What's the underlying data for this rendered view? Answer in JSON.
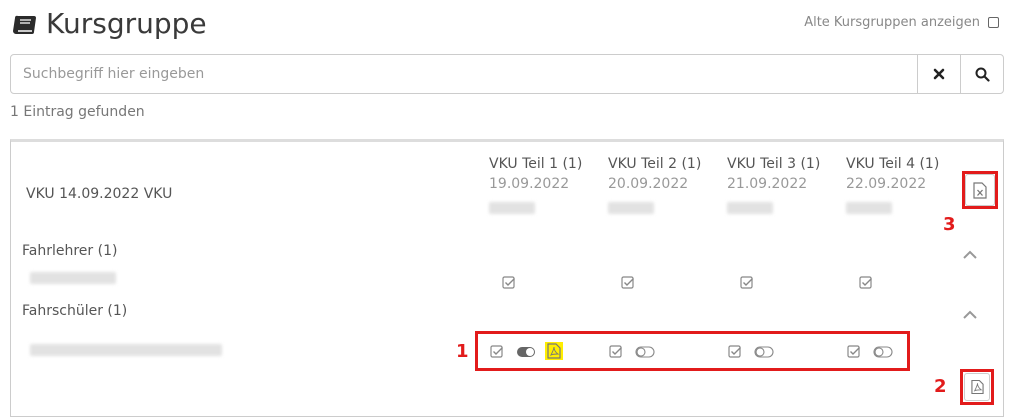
{
  "header": {
    "title": "Kursgruppe",
    "old_groups_label": "Alte Kursgruppen anzeigen"
  },
  "search": {
    "placeholder": "Suchbegriff hier eingeben",
    "value": ""
  },
  "result_count": "1 Eintrag gefunden",
  "course": {
    "name": "VKU 14.09.2022 VKU",
    "parts": [
      {
        "title": "VKU Teil 1 (1)",
        "date": "19.09.2022"
      },
      {
        "title": "VKU Teil 2 (1)",
        "date": "20.09.2022"
      },
      {
        "title": "VKU Teil 3 (1)",
        "date": "21.09.2022"
      },
      {
        "title": "VKU Teil 4 (1)",
        "date": "22.09.2022"
      }
    ],
    "sections": {
      "instructors": "Fahrlehrer (1)",
      "students": "Fahrschüler (1)"
    }
  },
  "annotations": [
    "1",
    "2",
    "3"
  ],
  "colors": {
    "highlight_red": "#e21b1b",
    "pdf_highlight": "#ffee00"
  }
}
